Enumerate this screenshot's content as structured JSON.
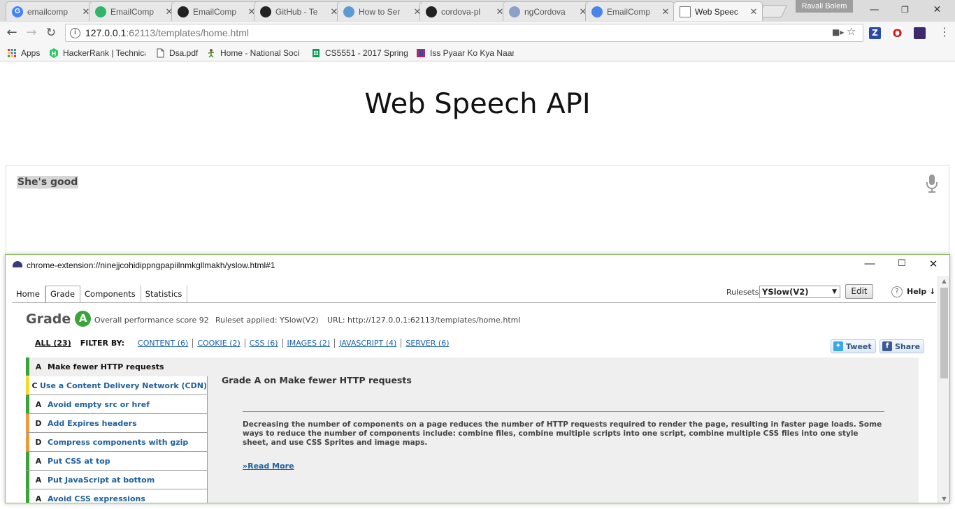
{
  "browser": {
    "tabs": [
      {
        "title": "emailcomp",
        "icon": "google-g-icon",
        "color": "#4285f4",
        "glyph": "G",
        "active": false
      },
      {
        "title": "EmailComp",
        "icon": "plugin-icon",
        "color": "#31b56a",
        "glyph": "",
        "active": false
      },
      {
        "title": "EmailComp",
        "icon": "github-icon",
        "color": "#222222",
        "glyph": "",
        "active": false
      },
      {
        "title": "GitHub - Te",
        "icon": "github-icon",
        "color": "#222222",
        "glyph": "",
        "active": false
      },
      {
        "title": "How to Ser",
        "icon": "cube-icon",
        "color": "#5c9ad6",
        "glyph": "",
        "active": false
      },
      {
        "title": "cordova-pl",
        "icon": "github-icon",
        "color": "#222222",
        "glyph": "",
        "active": false
      },
      {
        "title": "ngCordova",
        "icon": "shield-icon",
        "color": "#8aa2c8",
        "glyph": "",
        "active": false
      },
      {
        "title": "EmailComp",
        "icon": "chrome-icon",
        "color": "#4a86e8",
        "glyph": "",
        "active": false
      },
      {
        "title": "Web Speec",
        "icon": "page-icon",
        "color": "#ffffff",
        "glyph": "",
        "active": true
      }
    ],
    "profile_name": "Ravali Bolem",
    "url_host": "127.0.0.1",
    "url_rest": ":62113/templates/home.html",
    "bookmarks": [
      {
        "label": "Apps",
        "icon": "apps-grid-icon"
      },
      {
        "label": "HackerRank | Technica",
        "icon": "hackerrank-icon"
      },
      {
        "label": "Dsa.pdf",
        "icon": "document-icon"
      },
      {
        "label": "Home - National Soci",
        "icon": "figure-icon"
      },
      {
        "label": "CS5551 - 2017 Spring",
        "icon": "sheets-icon"
      },
      {
        "label": "Iss Pyaar Ko Kya Naam",
        "icon": "bookmark-icon"
      }
    ]
  },
  "page": {
    "title": "Web Speech API",
    "transcript": "She's good"
  },
  "popup": {
    "title_url": "chrome-extension://ninejjcohidippngpapiilnmkgllmakh/yslow.html#1",
    "nav_tabs": [
      "Home",
      "Grade",
      "Components",
      "Statistics"
    ],
    "active_tab": "Grade",
    "rulesets_label": "Rulesets",
    "ruleset_value": "YSlow(V2)",
    "edit_label": "Edit",
    "help_label": "Help ↓",
    "grade_label": "Grade",
    "grade_value": "A",
    "overall_score": "Overall performance score 92",
    "ruleset_applied": "Ruleset applied: YSlow(V2)",
    "url_info": "URL: http://127.0.0.1:62113/templates/home.html",
    "filter_all": "ALL (23)",
    "filter_by": "FILTER BY:",
    "filters": [
      "CONTENT (6)",
      "COOKIE (2)",
      "CSS (6)",
      "IMAGES (2)",
      "JAVASCRIPT (4)",
      "SERVER (6)"
    ],
    "tweet_label": "Tweet",
    "share_label": "Share",
    "rules": [
      {
        "grade": "A",
        "label": "Make fewer HTTP requests",
        "color": "#3aa339",
        "selected": true
      },
      {
        "grade": "C",
        "label": "Use a Content Delivery Network (CDN)",
        "color": "#f3dc2a",
        "selected": false
      },
      {
        "grade": "A",
        "label": "Avoid empty src or href",
        "color": "#3aa339",
        "selected": false
      },
      {
        "grade": "D",
        "label": "Add Expires headers",
        "color": "#e99c3c",
        "selected": false
      },
      {
        "grade": "D",
        "label": "Compress components with gzip",
        "color": "#e99c3c",
        "selected": false
      },
      {
        "grade": "A",
        "label": "Put CSS at top",
        "color": "#3aa339",
        "selected": false
      },
      {
        "grade": "A",
        "label": "Put JavaScript at bottom",
        "color": "#3aa339",
        "selected": false
      },
      {
        "grade": "A",
        "label": "Avoid CSS expressions",
        "color": "#3aa339",
        "selected": false
      }
    ],
    "detail_title": "Grade A on Make fewer HTTP requests",
    "detail_text": "Decreasing the number of components on a page reduces the number of HTTP requests required to render the page, resulting in faster page loads. Some ways to reduce the number of components include: combine files, combine multiple scripts into one script, combine multiple CSS files into one style sheet, and use CSS Sprites and image maps.",
    "read_more": "»Read More"
  }
}
